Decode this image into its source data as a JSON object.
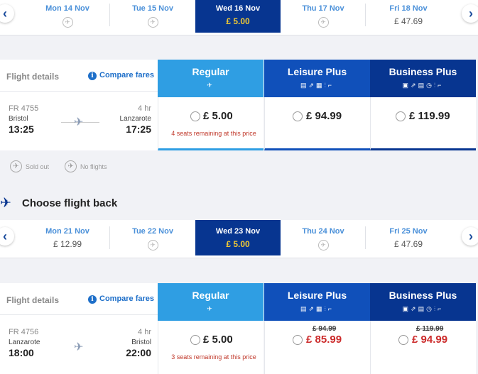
{
  "outbound": {
    "dates": [
      {
        "label": "Mon 14 Nov",
        "price": null,
        "selected": false
      },
      {
        "label": "Tue 15 Nov",
        "price": null,
        "selected": false
      },
      {
        "label": "Wed 16 Nov",
        "price": "£ 5.00",
        "selected": true
      },
      {
        "label": "Thu 17 Nov",
        "price": null,
        "selected": false
      },
      {
        "label": "Fri 18 Nov",
        "price": "£ 47.69",
        "selected": false
      }
    ],
    "flight": {
      "details_label": "Flight details",
      "compare_label": "Compare fares",
      "number": "FR 4755",
      "duration": "4 hr",
      "from_city": "Bristol",
      "to_city": "Lanzarote",
      "dep_time": "13:25",
      "arr_time": "17:25"
    },
    "fares": {
      "regular": {
        "name": "Regular",
        "price": "£ 5.00",
        "note": "4 seats remaining at this price"
      },
      "leisure": {
        "name": "Leisure Plus",
        "price": "£ 94.99"
      },
      "business": {
        "name": "Business Plus",
        "price": "£ 119.99"
      }
    }
  },
  "legend": {
    "sold_out": "Sold out",
    "no_flights": "No flights"
  },
  "return_title": "Choose flight back",
  "return": {
    "dates": [
      {
        "label": "Mon 21 Nov",
        "price": "£ 12.99",
        "selected": false
      },
      {
        "label": "Tue 22 Nov",
        "price": null,
        "selected": false
      },
      {
        "label": "Wed 23 Nov",
        "price": "£ 5.00",
        "selected": true
      },
      {
        "label": "Thu 24 Nov",
        "price": null,
        "selected": false
      },
      {
        "label": "Fri 25 Nov",
        "price": "£ 47.69",
        "selected": false
      }
    ],
    "flight": {
      "details_label": "Flight details",
      "compare_label": "Compare fares",
      "number": "FR 4756",
      "duration": "4 hr",
      "from_city": "Lanzarote",
      "to_city": "Bristol",
      "dep_time": "18:00",
      "arr_time": "22:00"
    },
    "fares": {
      "regular": {
        "name": "Regular",
        "price": "£ 5.00",
        "note": "3 seats remaining at this price"
      },
      "leisure": {
        "name": "Leisure Plus",
        "old_price": "£ 94.99",
        "price": "£ 85.99"
      },
      "business": {
        "name": "Business Plus",
        "old_price": "£ 119.99",
        "price": "£ 94.99"
      }
    }
  },
  "icons": {
    "nav_left": "chevron-left-icon",
    "nav_right": "chevron-right-icon",
    "plane": "plane-icon",
    "no_flight": "no-flight-icon"
  },
  "colors": {
    "selected_day": "#073590",
    "selected_price": "#f1c933",
    "regular": "#2f9ee3",
    "leisure": "#1050ba",
    "business": "#073590",
    "sale": "#cc2b2b"
  }
}
